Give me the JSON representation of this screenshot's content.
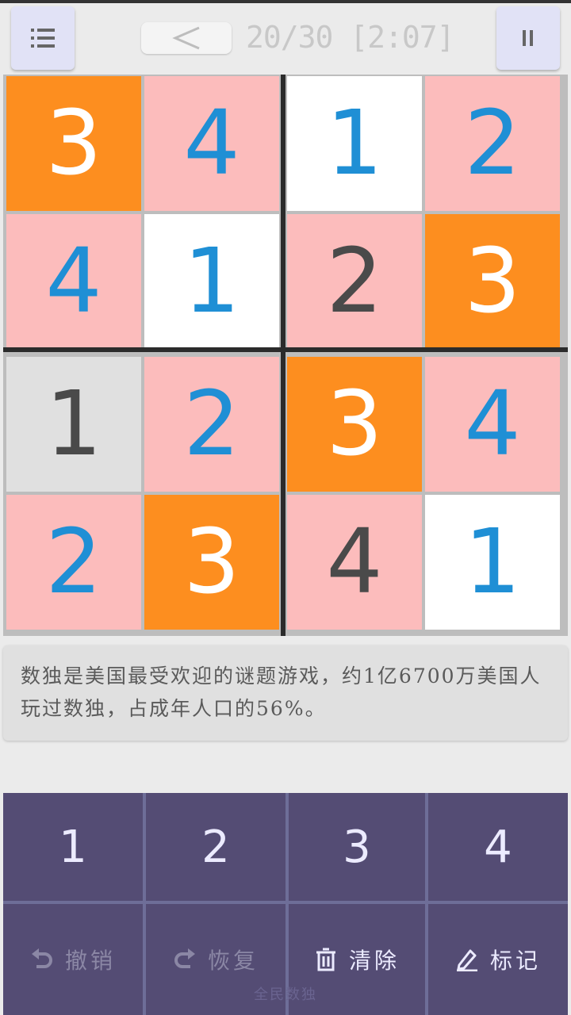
{
  "header": {
    "menu_icon": "menu-list-icon",
    "back_icon": "chevron-left-icon",
    "progress": "20/30 [2:07]",
    "pause_icon": "pause-icon"
  },
  "board": {
    "cells": [
      {
        "value": "3",
        "bg": "orange"
      },
      {
        "value": "4",
        "bg": "pink"
      },
      {
        "value": "1",
        "bg": "white"
      },
      {
        "value": "2",
        "bg": "pink"
      },
      {
        "value": "4",
        "bg": "pink"
      },
      {
        "value": "1",
        "bg": "white"
      },
      {
        "value": "2",
        "bg": "pink",
        "given": true
      },
      {
        "value": "3",
        "bg": "orange"
      },
      {
        "value": "1",
        "bg": "gray",
        "given": true
      },
      {
        "value": "2",
        "bg": "pink"
      },
      {
        "value": "3",
        "bg": "orange"
      },
      {
        "value": "4",
        "bg": "pink"
      },
      {
        "value": "2",
        "bg": "pink"
      },
      {
        "value": "3",
        "bg": "orange"
      },
      {
        "value": "4",
        "bg": "pink",
        "given": true
      },
      {
        "value": "1",
        "bg": "white"
      }
    ]
  },
  "info": {
    "text": "数独是美国最受欢迎的谜题游戏，约1亿6700万美国人玩过数独，占成年人口的56%。"
  },
  "keypad": {
    "numbers": [
      "1",
      "2",
      "3",
      "4"
    ],
    "actions": [
      {
        "label": "撤销",
        "icon": "undo-icon",
        "enabled": false
      },
      {
        "label": "恢复",
        "icon": "redo-icon",
        "enabled": false
      },
      {
        "label": "清除",
        "icon": "trash-icon",
        "enabled": true
      },
      {
        "label": "标记",
        "icon": "pencil-icon",
        "enabled": true
      }
    ]
  },
  "footer": {
    "text": "全民数独"
  },
  "colors": {
    "orange": "#fd8e1f",
    "pink": "#fcbcbc",
    "blue_digit": "#1f8fd5",
    "keypad": "#544c74"
  }
}
